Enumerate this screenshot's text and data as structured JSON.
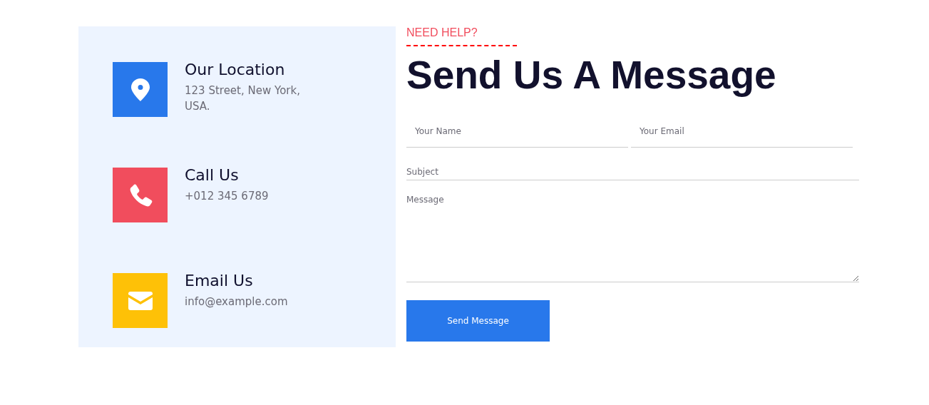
{
  "contacts": [
    {
      "kind": "location",
      "color": "#2878eb",
      "title": "Our Location",
      "detail": "123 Street, New York, USA."
    },
    {
      "kind": "phone",
      "color": "#f14d5d",
      "title": "Call Us",
      "detail": "+012 345 6789"
    },
    {
      "kind": "email",
      "color": "#fec107",
      "title": "Email Us",
      "detail": "info@example.com"
    }
  ],
  "form": {
    "eyebrow": "NEED HELP?",
    "heading": "Send Us A Message",
    "name_field": {
      "placeholder": "Your Name"
    },
    "email_field": {
      "placeholder": "Your Email"
    },
    "subject_field": {
      "placeholder": "Subject"
    },
    "message_field": {
      "placeholder": "Message"
    },
    "submit": "Send Message"
  }
}
